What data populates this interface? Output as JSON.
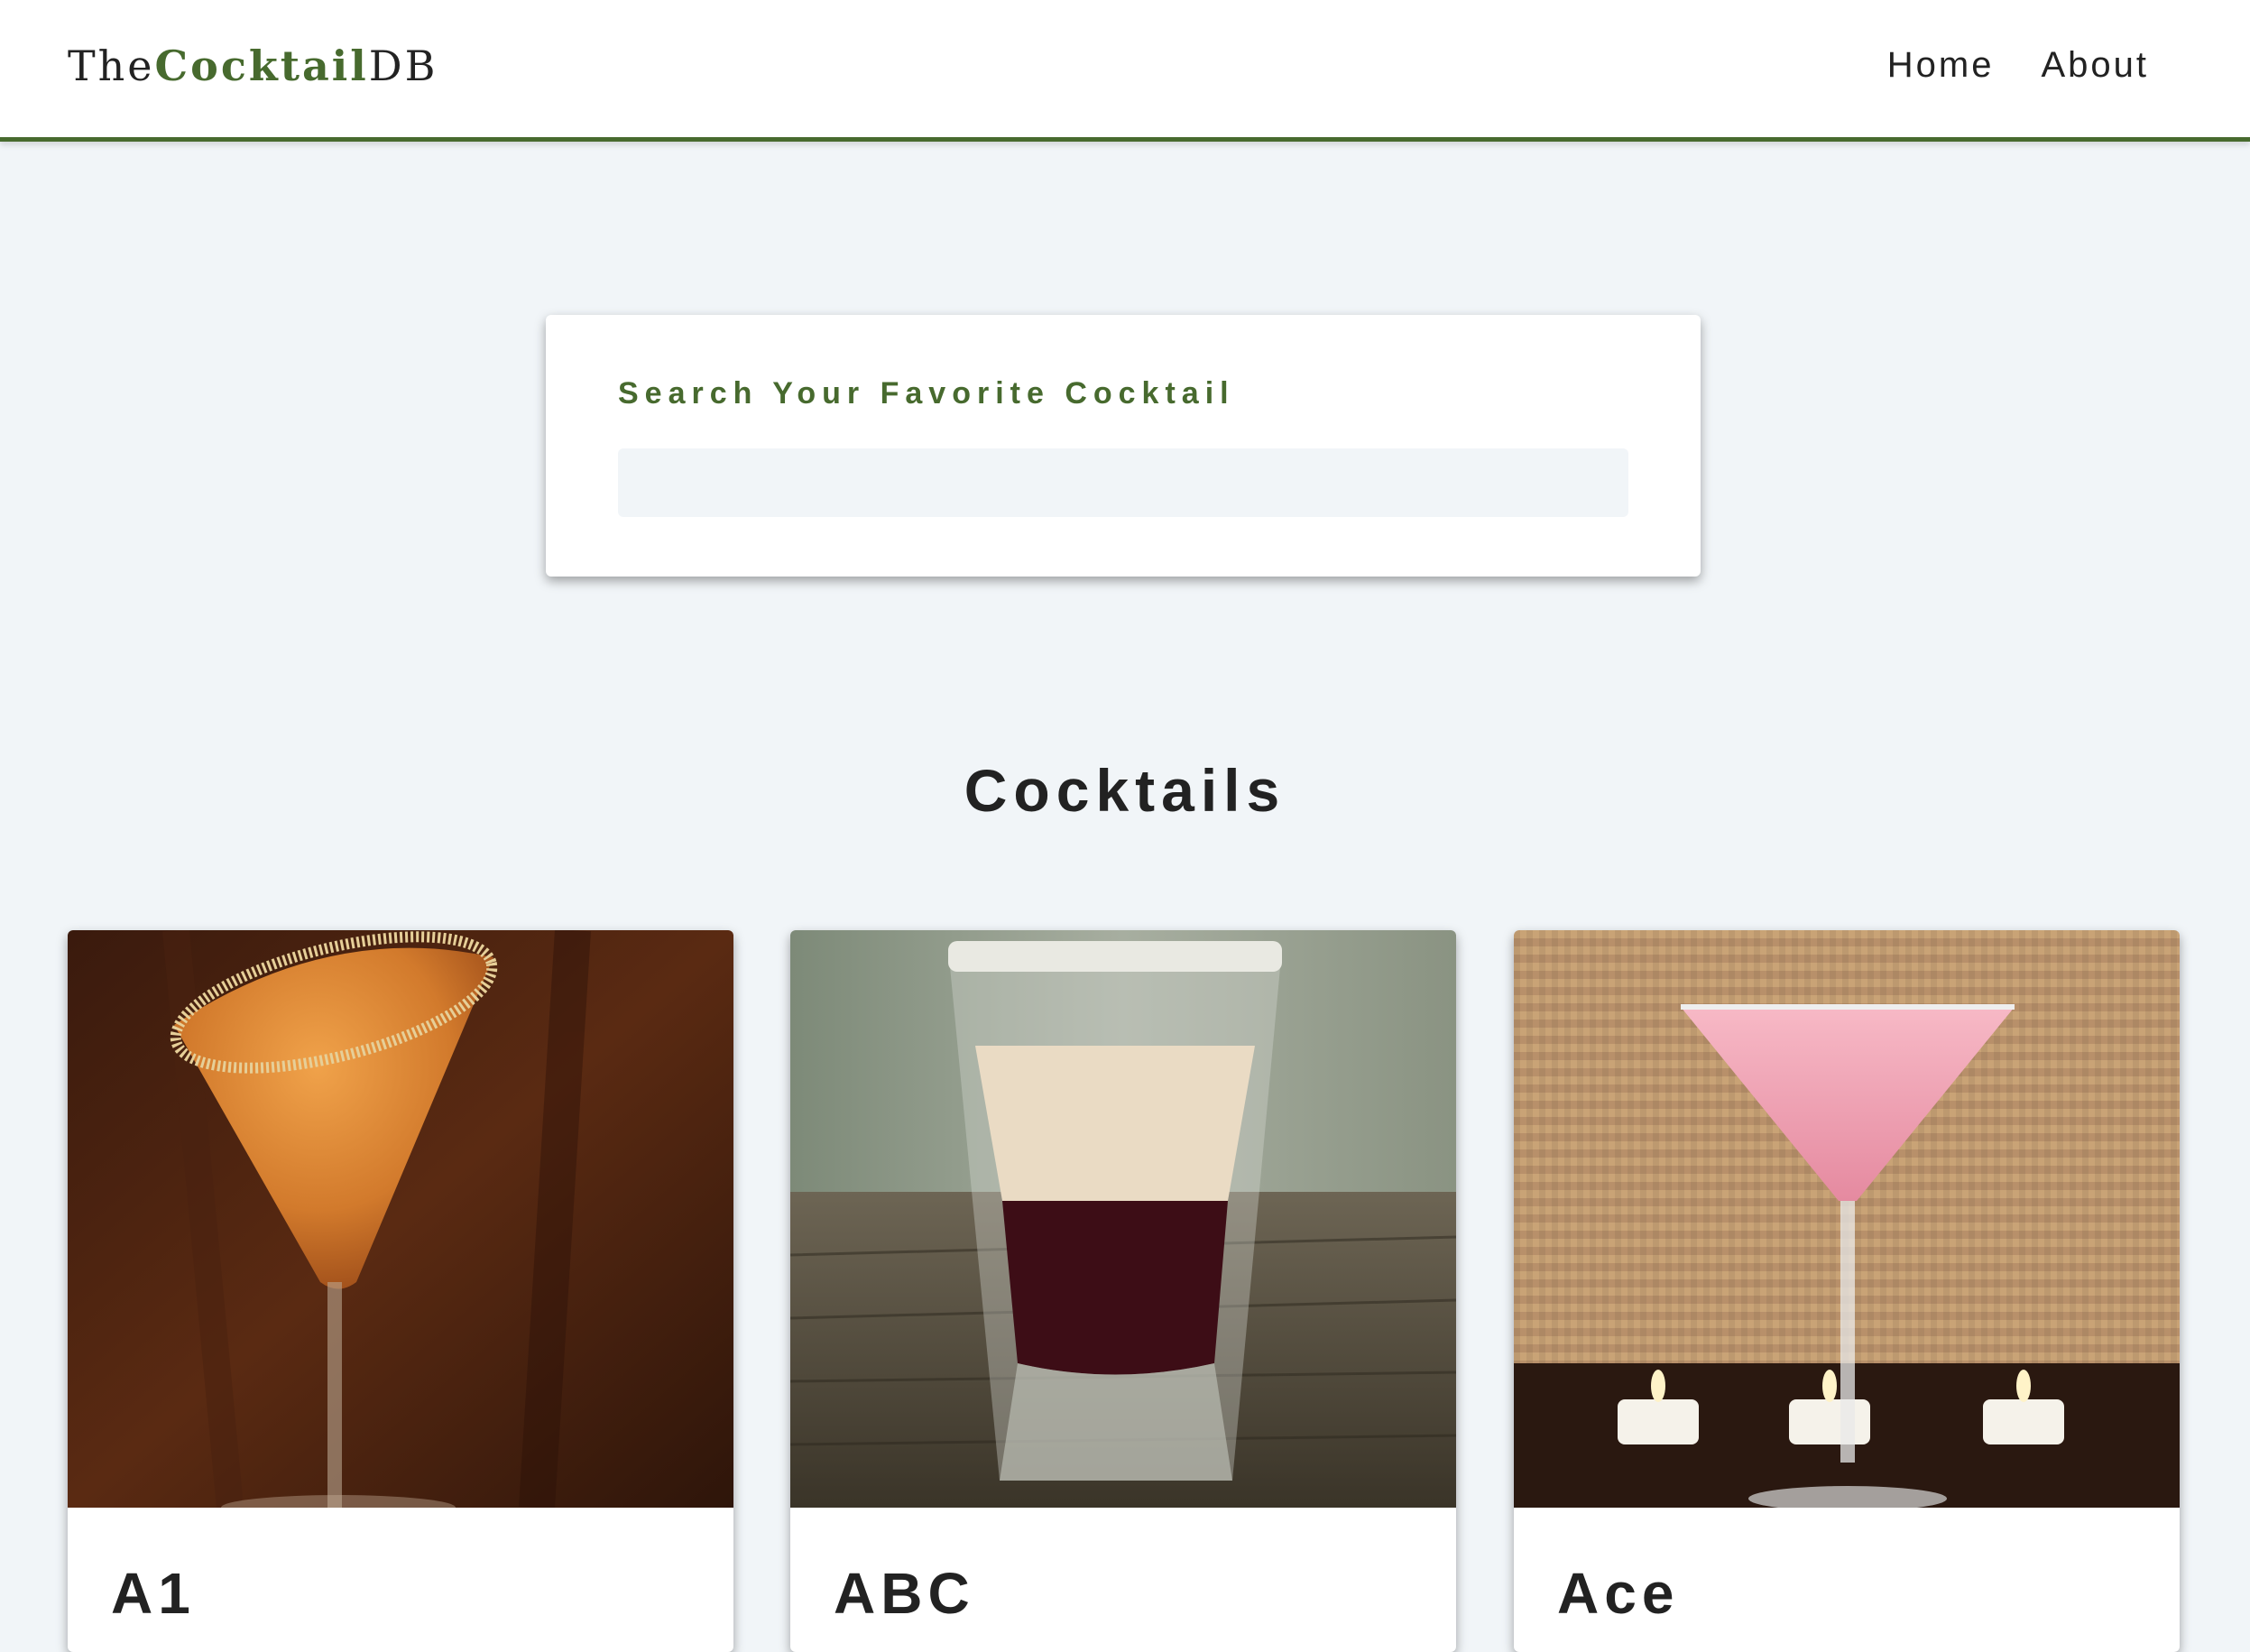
{
  "navbar": {
    "logo_prefix": "The",
    "logo_accent": "Cocktail",
    "logo_suffix": "DB",
    "links": [
      {
        "label": "Home"
      },
      {
        "label": "About"
      }
    ]
  },
  "search": {
    "label": "Search Your Favorite Cocktail",
    "value": "",
    "placeholder": ""
  },
  "section": {
    "title": "Cocktails"
  },
  "cocktails": [
    {
      "name": "A1"
    },
    {
      "name": "ABC"
    },
    {
      "name": "Ace"
    }
  ],
  "colors": {
    "accent": "#476a2e",
    "background": "#f1f5f8",
    "text": "#222222"
  }
}
